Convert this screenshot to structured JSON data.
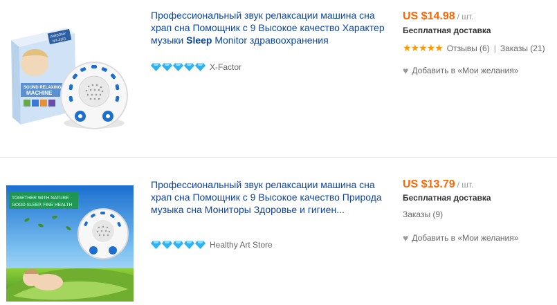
{
  "products": [
    {
      "title_part1": "Профессиональный звук релаксации машина сна храп сна Помощник с 9 Высокое качество Характер музыки ",
      "title_highlight": "Sleep",
      "title_part2": " Monitor здравоохранения",
      "store": "X-Factor",
      "price": "US $14.98",
      "unit": "/ шт.",
      "shipping": "Бесплатная доставка",
      "stars": "★★★★★",
      "reviews": "Отзывы (6)",
      "separator": "|",
      "orders": "Заказы (21)",
      "wishlist": "Добавить в «Мои желания»",
      "image_texts": {
        "brand": "AMISONY",
        "model": "MT-3101",
        "box_line1": "SOUND RELAXING",
        "box_line2": "MACHINE"
      }
    },
    {
      "title_full": "Профессиональный звук релаксации машина сна храп сна Помощник с 9 Высокое качество Природа музыка сна Мониторы Здоровье и гигиен...",
      "store": "Healthy Art Store",
      "price": "US $13.79",
      "unit": "/ шт.",
      "shipping": "Бесплатная доставка",
      "orders": "Заказы (9)",
      "wishlist": "Добавить в «Мои желания»",
      "image_texts": {
        "banner_line1": "TOGETHER WITH NATURE",
        "banner_line2": "GOOD SLEEP, FINE HEALTH"
      }
    }
  ],
  "colors": {
    "title_link": "#0b45a5",
    "price": "#ff6600",
    "stars": "#ff9900",
    "diamond": "#2fb3f0"
  }
}
